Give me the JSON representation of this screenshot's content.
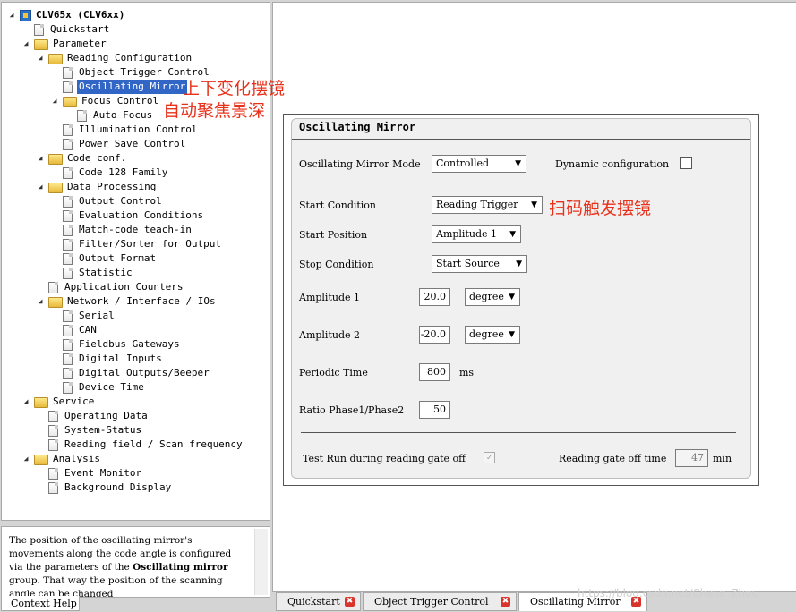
{
  "tree": [
    {
      "label": "CLV65x (CLV6xx)",
      "icon": "device-icon",
      "expander": "expanded",
      "level": 0,
      "bold": true
    },
    {
      "label": "Quickstart",
      "icon": "document-icon",
      "expander": "",
      "level": 1
    },
    {
      "label": "Parameter",
      "icon": "folder-icon",
      "expander": "expanded",
      "level": 1
    },
    {
      "label": "Reading Configuration",
      "icon": "folder-icon",
      "expander": "expanded",
      "level": 2
    },
    {
      "label": "Object Trigger Control",
      "icon": "document-icon",
      "expander": "",
      "level": 3
    },
    {
      "label": "Oscillating Mirror",
      "icon": "document-icon",
      "expander": "",
      "level": 3,
      "selected": true
    },
    {
      "label": "Focus Control",
      "icon": "folder-icon",
      "expander": "expanded",
      "level": 3
    },
    {
      "label": "Auto Focus",
      "icon": "document-icon",
      "expander": "",
      "level": 4
    },
    {
      "label": "Illumination Control",
      "icon": "document-icon",
      "expander": "",
      "level": 3
    },
    {
      "label": "Power Save Control",
      "icon": "document-icon",
      "expander": "",
      "level": 3
    },
    {
      "label": "Code conf.",
      "icon": "folder-icon",
      "expander": "expanded",
      "level": 2
    },
    {
      "label": "Code 128 Family",
      "icon": "document-icon",
      "expander": "",
      "level": 3
    },
    {
      "label": "Data Processing",
      "icon": "folder-icon",
      "expander": "expanded",
      "level": 2
    },
    {
      "label": "Output Control",
      "icon": "document-icon",
      "expander": "",
      "level": 3
    },
    {
      "label": "Evaluation Conditions",
      "icon": "document-icon",
      "expander": "",
      "level": 3
    },
    {
      "label": "Match-code teach-in",
      "icon": "document-icon",
      "expander": "",
      "level": 3
    },
    {
      "label": "Filter/Sorter for Output",
      "icon": "document-icon",
      "expander": "",
      "level": 3
    },
    {
      "label": "Output Format",
      "icon": "document-icon",
      "expander": "",
      "level": 3
    },
    {
      "label": "Statistic",
      "icon": "document-icon",
      "expander": "",
      "level": 3
    },
    {
      "label": "Application Counters",
      "icon": "document-icon",
      "expander": "",
      "level": 2
    },
    {
      "label": "Network / Interface / IOs",
      "icon": "folder-icon",
      "expander": "expanded",
      "level": 2
    },
    {
      "label": "Serial",
      "icon": "document-icon",
      "expander": "",
      "level": 3
    },
    {
      "label": "CAN",
      "icon": "document-icon",
      "expander": "",
      "level": 3
    },
    {
      "label": "Fieldbus Gateways",
      "icon": "document-icon",
      "expander": "",
      "level": 3
    },
    {
      "label": "Digital Inputs",
      "icon": "document-icon",
      "expander": "",
      "level": 3
    },
    {
      "label": "Digital Outputs/Beeper",
      "icon": "document-icon",
      "expander": "",
      "level": 3
    },
    {
      "label": "Device Time",
      "icon": "document-icon",
      "expander": "",
      "level": 3
    },
    {
      "label": "Service",
      "icon": "folder-icon",
      "expander": "expanded",
      "level": 1
    },
    {
      "label": "Operating Data",
      "icon": "document-icon",
      "expander": "",
      "level": 2
    },
    {
      "label": "System-Status",
      "icon": "document-icon",
      "expander": "",
      "level": 2
    },
    {
      "label": "Reading field / Scan frequency",
      "icon": "document-icon",
      "expander": "",
      "level": 2
    },
    {
      "label": "Analysis",
      "icon": "folder-icon",
      "expander": "expanded",
      "level": 1
    },
    {
      "label": "Event Monitor",
      "icon": "document-icon",
      "expander": "",
      "level": 2
    },
    {
      "label": "Background Display",
      "icon": "document-icon",
      "expander": "",
      "level": 2
    }
  ],
  "annotations": {
    "osc_line1": "上下变化摆镜",
    "osc_line2": "自动聚焦景深",
    "start_condition": "扫码触发摆镜"
  },
  "help": {
    "text_before": "The position of the oscillating mirror's movements along the code angle is configured via the parameters of the ",
    "text_bold": "Oscillating mirror",
    "text_after": " group. That way the position of the scanning angle can be changed",
    "tab_label": "Context Help"
  },
  "panel": {
    "title": "Oscillating Mirror",
    "mode_label": "Oscillating Mirror Mode",
    "mode_value": "Controlled",
    "dynamic_label": "Dynamic configuration",
    "start_condition_label": "Start Condition",
    "start_condition_value": "Reading Trigger",
    "start_position_label": "Start Position",
    "start_position_value": "Amplitude 1",
    "stop_condition_label": "Stop Condition",
    "stop_condition_value": "Start Source",
    "amplitude1_label": "Amplitude 1",
    "amplitude1_value": "20.0",
    "amplitude1_unit": "degree",
    "amplitude2_label": "Amplitude 2",
    "amplitude2_value": "-20.0",
    "amplitude2_unit": "degree",
    "periodic_label": "Periodic Time",
    "periodic_value": "800",
    "periodic_unit": "ms",
    "ratio_label": "Ratio Phase1/Phase2",
    "ratio_value": "50",
    "test_run_label": "Test Run during reading gate off",
    "gate_off_label": "Reading gate off time",
    "gate_off_value": "47",
    "gate_off_unit": "min"
  },
  "tabs": [
    {
      "label": "Quickstart",
      "active": false
    },
    {
      "label": "Object Trigger Control",
      "active": false
    },
    {
      "label": "Oscillating Mirror",
      "active": true
    }
  ],
  "watermark": "https://blog.csdn.net/Chase_Zhou",
  "colors": {
    "selection": "#3166c6",
    "annotation": "#e8311a",
    "close": "#d9342b"
  }
}
